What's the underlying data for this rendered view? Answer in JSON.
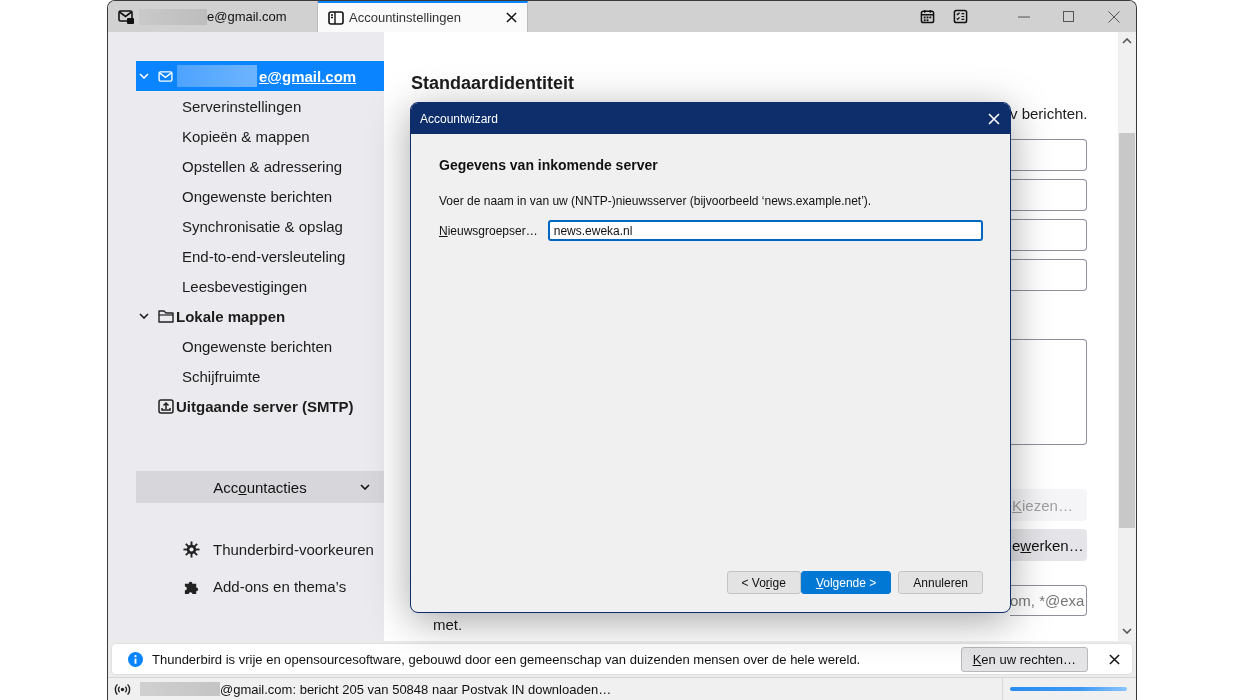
{
  "tabs": [
    {
      "label": "e@gmail.com",
      "kind": "mail",
      "selected": false
    },
    {
      "label": "Accountinstellingen",
      "kind": "settings",
      "selected": true
    }
  ],
  "sidebar": {
    "accounts": [
      {
        "label": "e@gmail.com",
        "kind": "mail",
        "expanded": true,
        "selected": true,
        "children": [
          {
            "label": "Serverinstellingen",
            "selected": false
          },
          {
            "label": "Kopieën & mappen",
            "selected": false
          },
          {
            "label": "Opstellen & adressering",
            "selected": false
          },
          {
            "label": "Ongewenste berichten",
            "selected": false
          },
          {
            "label": "Synchronisatie & opslag",
            "selected": false
          },
          {
            "label": "End-to-end-versleuteling",
            "selected": false
          },
          {
            "label": "Leesbevestigingen",
            "selected": false
          }
        ]
      },
      {
        "label": "Lokale mappen",
        "kind": "folder",
        "expanded": true,
        "selected": false,
        "children": [
          {
            "label": "Ongewenste berichten",
            "selected": false
          },
          {
            "label": "Schijfruimte",
            "selected": false
          }
        ]
      },
      {
        "label": "Uitgaande server (SMTP)",
        "kind": "outbox",
        "selected": false
      }
    ],
    "account_actions": {
      "label_start": "Acc",
      "access_key": "o",
      "label_end": "untacties"
    },
    "links": [
      {
        "label": "Thunderbird-voorkeuren",
        "kind": "gear"
      },
      {
        "label": "Add-ons en thema’s",
        "kind": "puzzle"
      }
    ]
  },
  "content": {
    "heading": "Standaardidentiteit",
    "note_fragment": "v berichten.",
    "choose_button": {
      "access_key": "K",
      "label_end": "iezen…",
      "disabled": true
    },
    "edit_button": {
      "label_start": "e",
      "access_key": "w",
      "label_end": "erken…",
      "disabled": false
    },
    "filter_field": {
      "placeholder": "om, *@exa"
    },
    "trailing_text": "met."
  },
  "dialog": {
    "title": "Accountwizard",
    "heading": "Gegevens van inkomende server",
    "description": "Voer de naam in van uw (NNTP-)nieuwsserver (bijvoorbeeld ‘news.example.net’).",
    "field": {
      "access_key": "N",
      "label_end": "ieuwsgroepser…",
      "value": "news.eweka.nl"
    },
    "buttons": [
      {
        "label_start": "< Vo",
        "access_key": "r",
        "label_end": "ige",
        "kind": "normal"
      },
      {
        "access_key": "V",
        "label_end": "olgende >",
        "kind": "default"
      },
      {
        "label": "Annuleren",
        "kind": "normal"
      }
    ]
  },
  "notification": {
    "text": "Thunderbird is vrije en opensourcesoftware, gebouwd door een gemeenschap van duizenden mensen over de hele wereld.",
    "button": {
      "access_key": "K",
      "label_end": "en uw rechten…"
    }
  },
  "status_bar": {
    "text": "@gmail.com: bericht 205 van 50848 naar Postvak IN downloaden…",
    "progress": {
      "level": 1
    }
  }
}
